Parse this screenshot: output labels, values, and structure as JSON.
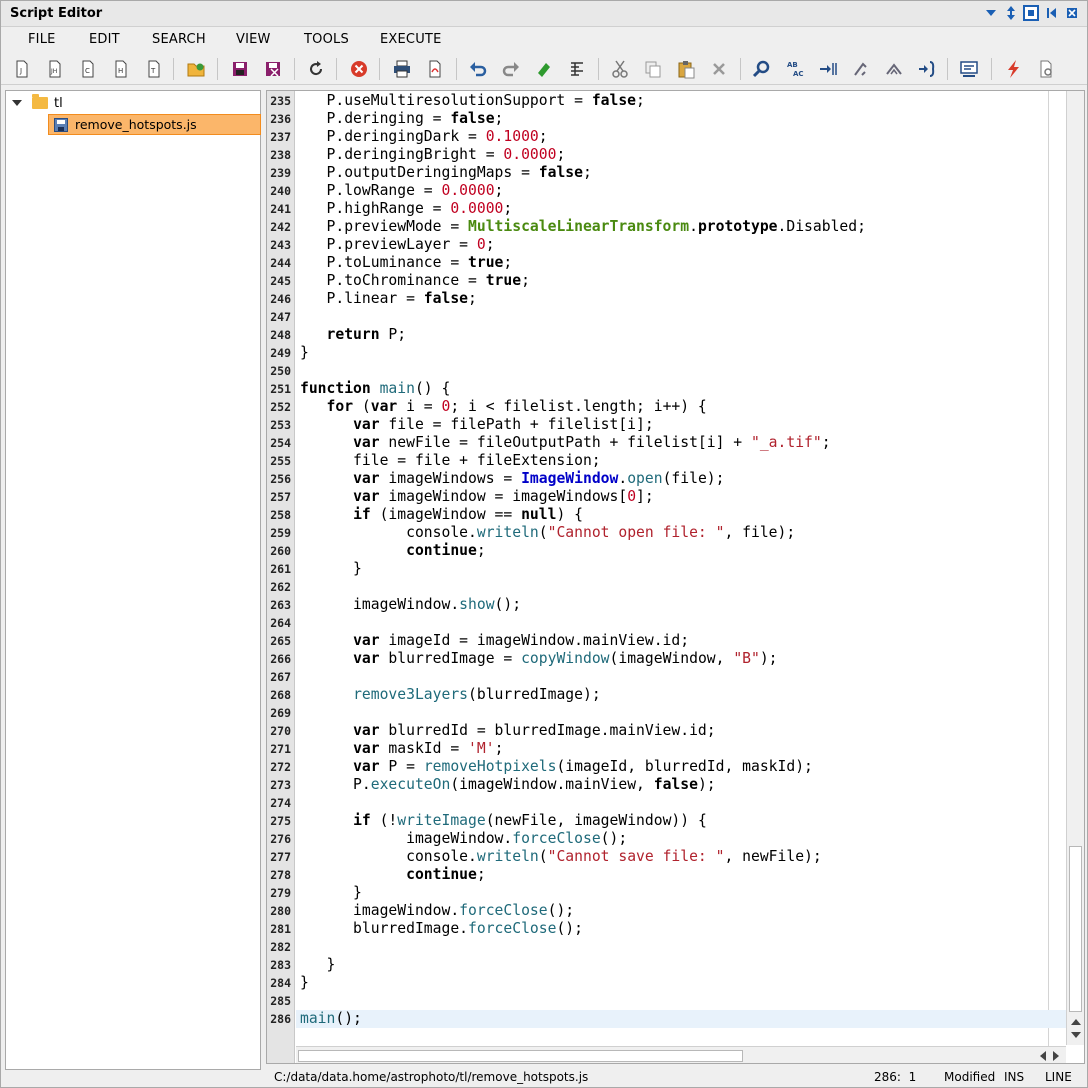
{
  "window": {
    "title": "Script Editor"
  },
  "menu": [
    "FILE",
    "EDIT",
    "SEARCH",
    "VIEW",
    "TOOLS",
    "EXECUTE"
  ],
  "toolbar": [
    "new-js-file-icon",
    "new-jsh-file-icon",
    "new-c-file-icon",
    "new-h-file-icon",
    "new-text-file-icon",
    "open-file-icon",
    "save-icon",
    "save-all-icon",
    "reload-icon",
    "close-file-icon",
    "print-icon",
    "export-pdf-icon",
    "undo-icon",
    "redo-icon",
    "clear-icon",
    "format-icon",
    "cut-icon",
    "copy-icon",
    "paste-icon",
    "delete-icon",
    "find-icon",
    "replace-icon",
    "indent-icon",
    "unindent-icon",
    "jump-icon",
    "block-icon",
    "comment-icon",
    "execute-icon",
    "settings-icon"
  ],
  "tree": {
    "root_label": "tl",
    "file_label": "remove_hotspots.js"
  },
  "editor": {
    "first_line": 235,
    "current_line": 286,
    "lines": [
      "   P.useMultiresolutionSupport = false;",
      "   P.deringing = false;",
      "   P.deringingDark = 0.1000;",
      "   P.deringingBright = 0.0000;",
      "   P.outputDeringingMaps = false;",
      "   P.lowRange = 0.0000;",
      "   P.highRange = 0.0000;",
      "   P.previewMode = MultiscaleLinearTransform.prototype.Disabled;",
      "   P.previewLayer = 0;",
      "   P.toLuminance = true;",
      "   P.toChrominance = true;",
      "   P.linear = false;",
      "",
      "   return P;",
      "}",
      "",
      "function main() {",
      "   for (var i = 0; i < filelist.length; i++) {",
      "      var file = filePath + filelist[i];",
      "      var newFile = fileOutputPath + filelist[i] + \"_a.tif\";",
      "      file = file + fileExtension;",
      "      var imageWindows = ImageWindow.open(file);",
      "      var imageWindow = imageWindows[0];",
      "      if (imageWindow == null) {",
      "            console.writeln(\"Cannot open file: \", file);",
      "            continue;",
      "      }",
      "",
      "      imageWindow.show();",
      "",
      "      var imageId = imageWindow.mainView.id;",
      "      var blurredImage = copyWindow(imageWindow, \"B\");",
      "",
      "      remove3Layers(blurredImage);",
      "",
      "      var blurredId = blurredImage.mainView.id;",
      "      var maskId = 'M';",
      "      var P = removeHotpixels(imageId, blurredId, maskId);",
      "      P.executeOn(imageWindow.mainView, false);",
      "",
      "      if (!writeImage(newFile, imageWindow)) {",
      "            imageWindow.forceClose();",
      "            console.writeln(\"Cannot save file: \", newFile);",
      "            continue;",
      "      }",
      "      imageWindow.forceClose();",
      "      blurredImage.forceClose();",
      "",
      "   }",
      "}",
      "",
      "main();"
    ]
  },
  "status": {
    "path": "C:/data/data.home/astrophoto/tl/remove_hotspots.js",
    "cursor": "286:  1",
    "modified": "Modified",
    "mode": "INS",
    "select": "LINE"
  },
  "colors": {
    "keyword": "#000000",
    "number": "#c00020",
    "string": "#b0222d",
    "method": "#1f6a7a",
    "class": "#0000c8",
    "proto_class": "#4a8a10",
    "selection": "#fbb66a"
  }
}
